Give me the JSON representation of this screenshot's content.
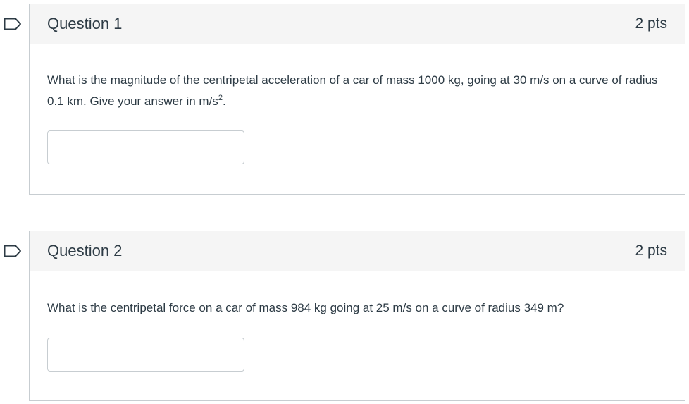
{
  "questions": [
    {
      "title": "Question 1",
      "points": "2 pts",
      "text_main": "What is the magnitude of the centripetal acceleration of a car of mass 1000 kg, going at 30 m/s on a curve of radius 0.1 km. Give your answer in m/s",
      "text_sup": "2",
      "text_end": ".",
      "answer_value": ""
    },
    {
      "title": "Question 2",
      "points": "2 pts",
      "text_main": "What is the centripetal force on a car of mass 984 kg going at 25 m/s on a curve of radius 349 m?",
      "answer_value": ""
    }
  ],
  "icons": {
    "flag": "bookmark-flag-icon"
  }
}
